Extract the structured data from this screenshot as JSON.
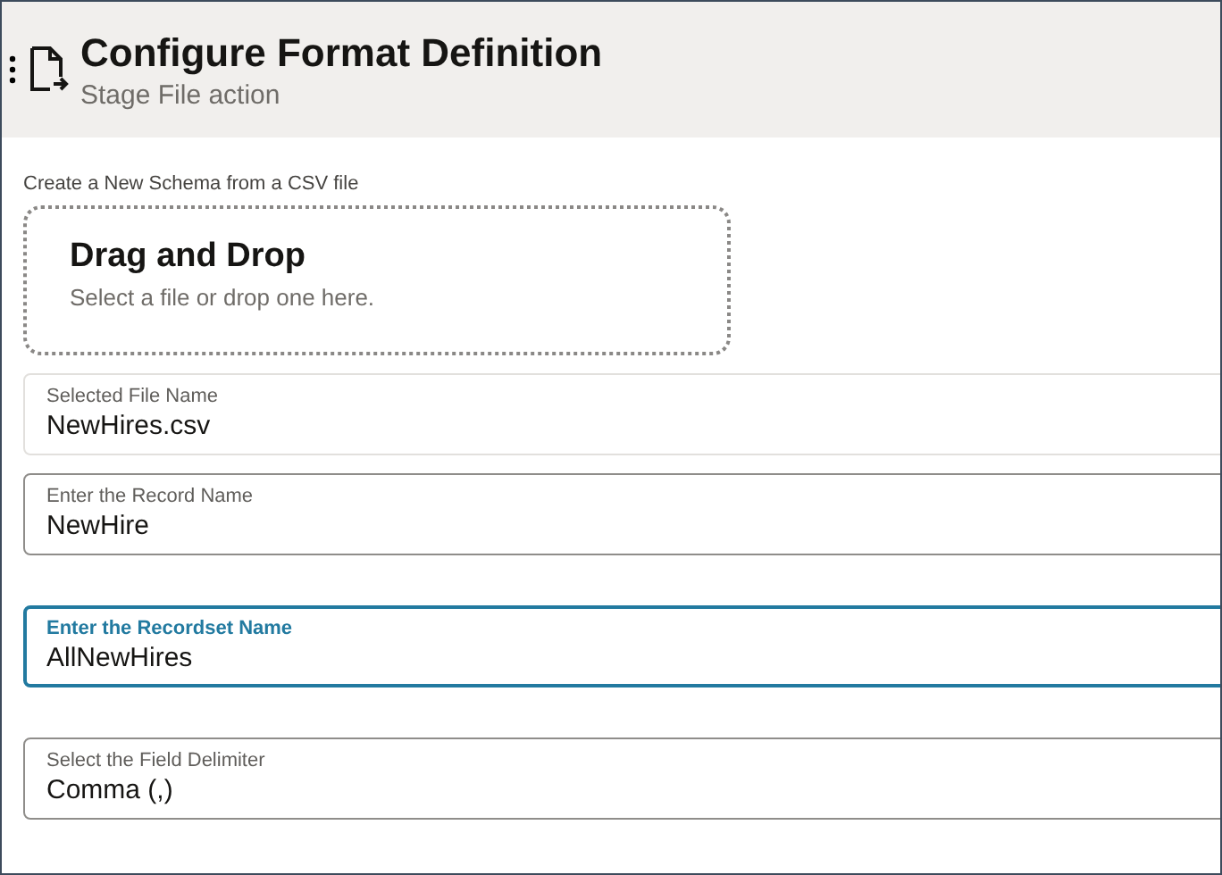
{
  "header": {
    "title": "Configure Format Definition",
    "subtitle": "Stage File action"
  },
  "upload": {
    "label": "Create a New Schema from a CSV file",
    "title": "Drag and Drop",
    "hint": "Select a file or drop one here."
  },
  "fields": [
    {
      "label": "Selected File Name",
      "value": "NewHires.csv",
      "kind": "readonly",
      "focused": false
    },
    {
      "label": "Enter the Record Name",
      "value": "NewHire",
      "kind": "text",
      "focused": false
    },
    {
      "label": "Enter the Recordset Name",
      "value": "AllNewHires",
      "kind": "text",
      "focused": true
    },
    {
      "label": "Select the Field Delimiter",
      "value": "Comma (,)",
      "kind": "select",
      "focused": false
    }
  ]
}
